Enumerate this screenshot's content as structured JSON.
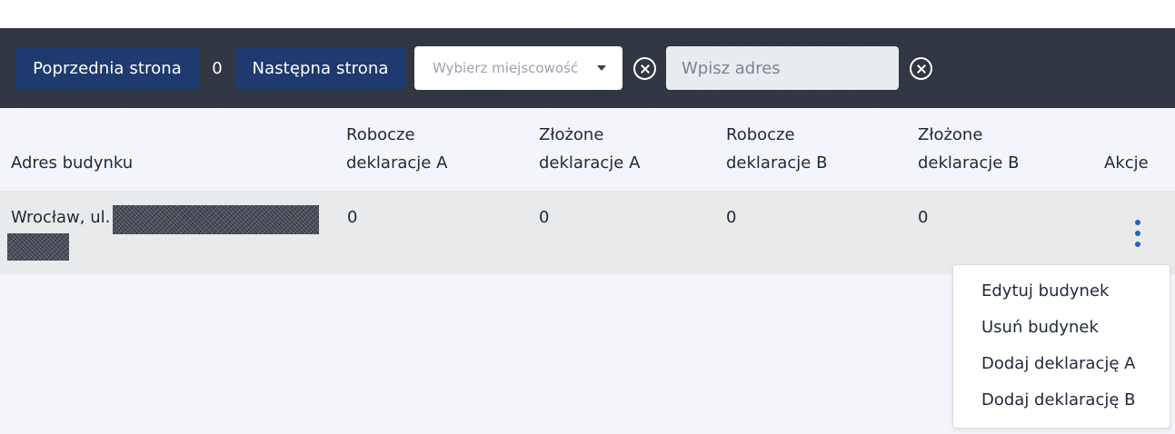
{
  "toolbar": {
    "prev_label": "Poprzednia strona",
    "page_number": "0",
    "next_label": "Następna strona",
    "city_select": {
      "placeholder": "Wybierz miejscowość"
    },
    "address_input": {
      "placeholder": "Wpisz adres",
      "value": ""
    },
    "colors": {
      "bar": "#2f3541",
      "button": "#1e3a6e"
    }
  },
  "table": {
    "headers": {
      "address": "Adres budynku",
      "draft_a_line1": "Robocze",
      "draft_a_line2": "deklaracje A",
      "filed_a_line1": "Złożone",
      "filed_a_line2": "deklaracje A",
      "draft_b_line1": "Robocze",
      "draft_b_line2": "deklaracje B",
      "filed_b_line1": "Złożone",
      "filed_b_line2": "deklaracje B",
      "actions": "Akcje"
    },
    "rows": [
      {
        "address": "Wrocław, ul.",
        "draft_a": "0",
        "filed_a": "0",
        "draft_b": "0",
        "filed_b": "0"
      }
    ]
  },
  "actions_menu": {
    "items": [
      "Edytuj budynek",
      "Usuń budynek",
      "Dodaj deklarację A",
      "Dodaj deklarację B"
    ],
    "icon": "kebab-menu-icon",
    "accent_color": "#2563b8"
  }
}
